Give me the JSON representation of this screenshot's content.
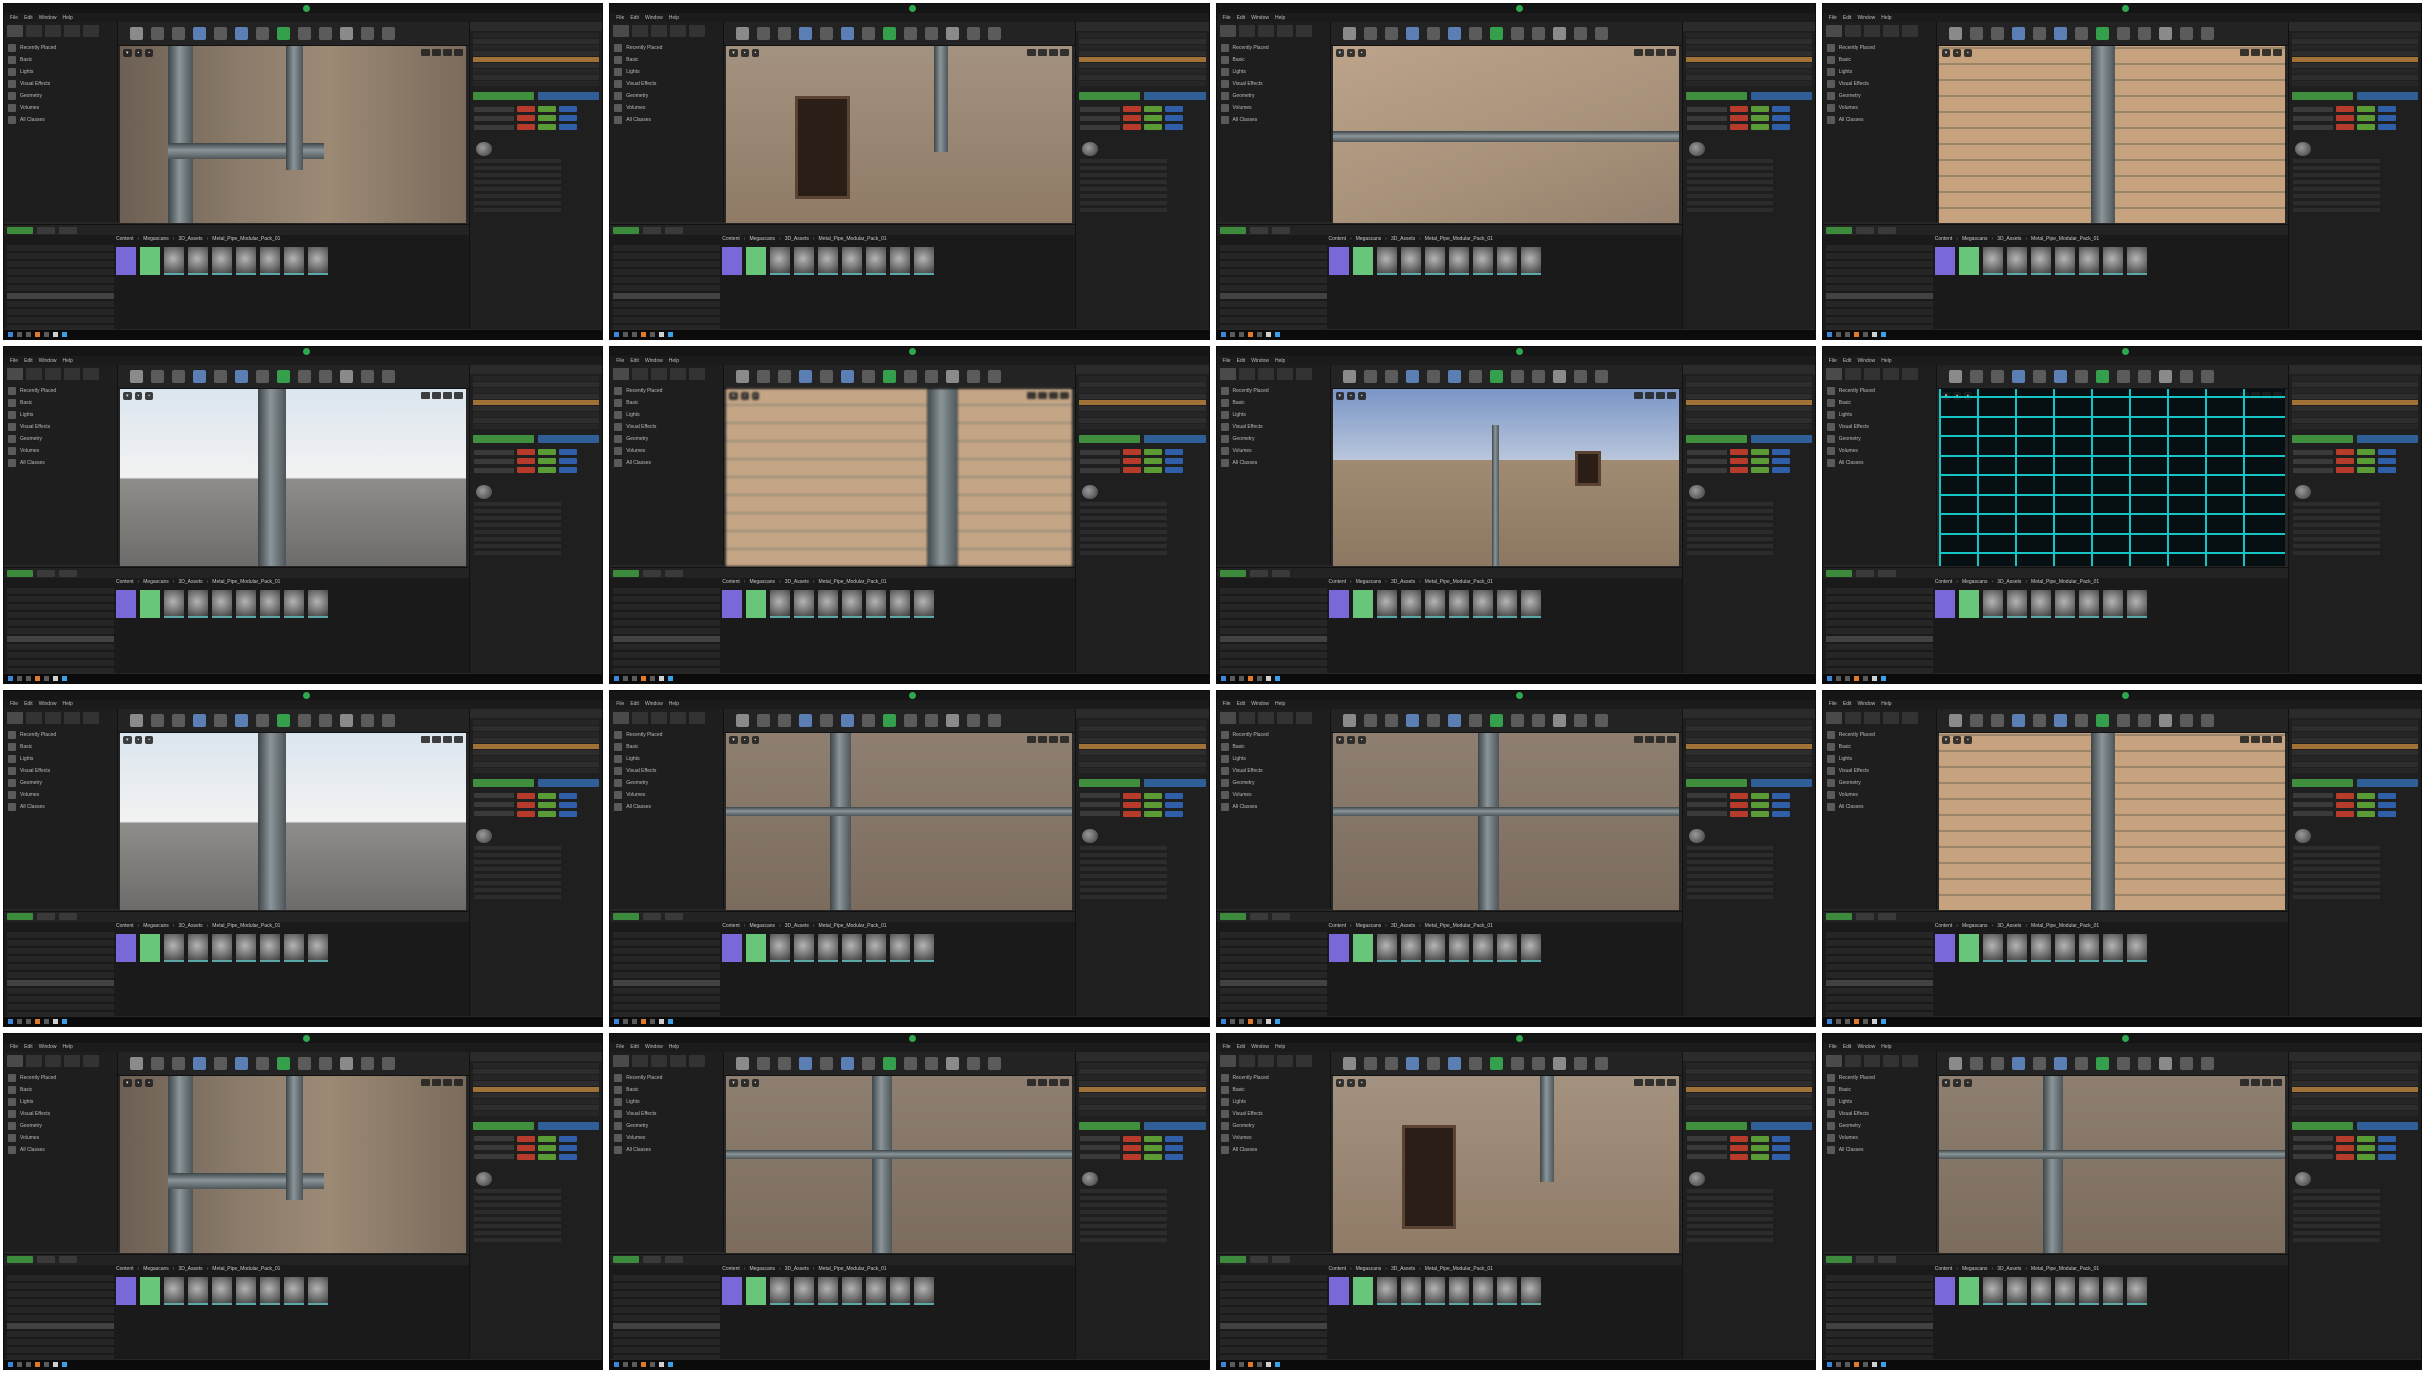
{
  "menu": [
    "File",
    "Edit",
    "Window",
    "Help"
  ],
  "modes_places": [
    "Recently Placed",
    "Basic",
    "Lights",
    "Visual Effects",
    "Geometry",
    "Volumes",
    "All Classes"
  ],
  "content_browser": {
    "breadcrumb": [
      "Content",
      "Megascans",
      "3D_Assets",
      "Metal_Pipe_Modular_Pack_01"
    ]
  },
  "frames": [
    {
      "scene": "pipe-brick"
    },
    {
      "scene": "window"
    },
    {
      "scene": "wall-yellow"
    },
    {
      "scene": "brick-closeup"
    },
    {
      "scene": "sky"
    },
    {
      "scene": "blurbrick"
    },
    {
      "scene": "building"
    },
    {
      "scene": "wire"
    },
    {
      "scene": "sky"
    },
    {
      "scene": "stone"
    },
    {
      "scene": "stone"
    },
    {
      "scene": "brick-closeup"
    },
    {
      "scene": "pipe-brick"
    },
    {
      "scene": "stone"
    },
    {
      "scene": "window"
    },
    {
      "scene": "stone"
    }
  ],
  "colors": {
    "accent_green": "#35a04b",
    "selection_orange": "#a07238",
    "wire_cyan": "#16c4c4"
  }
}
